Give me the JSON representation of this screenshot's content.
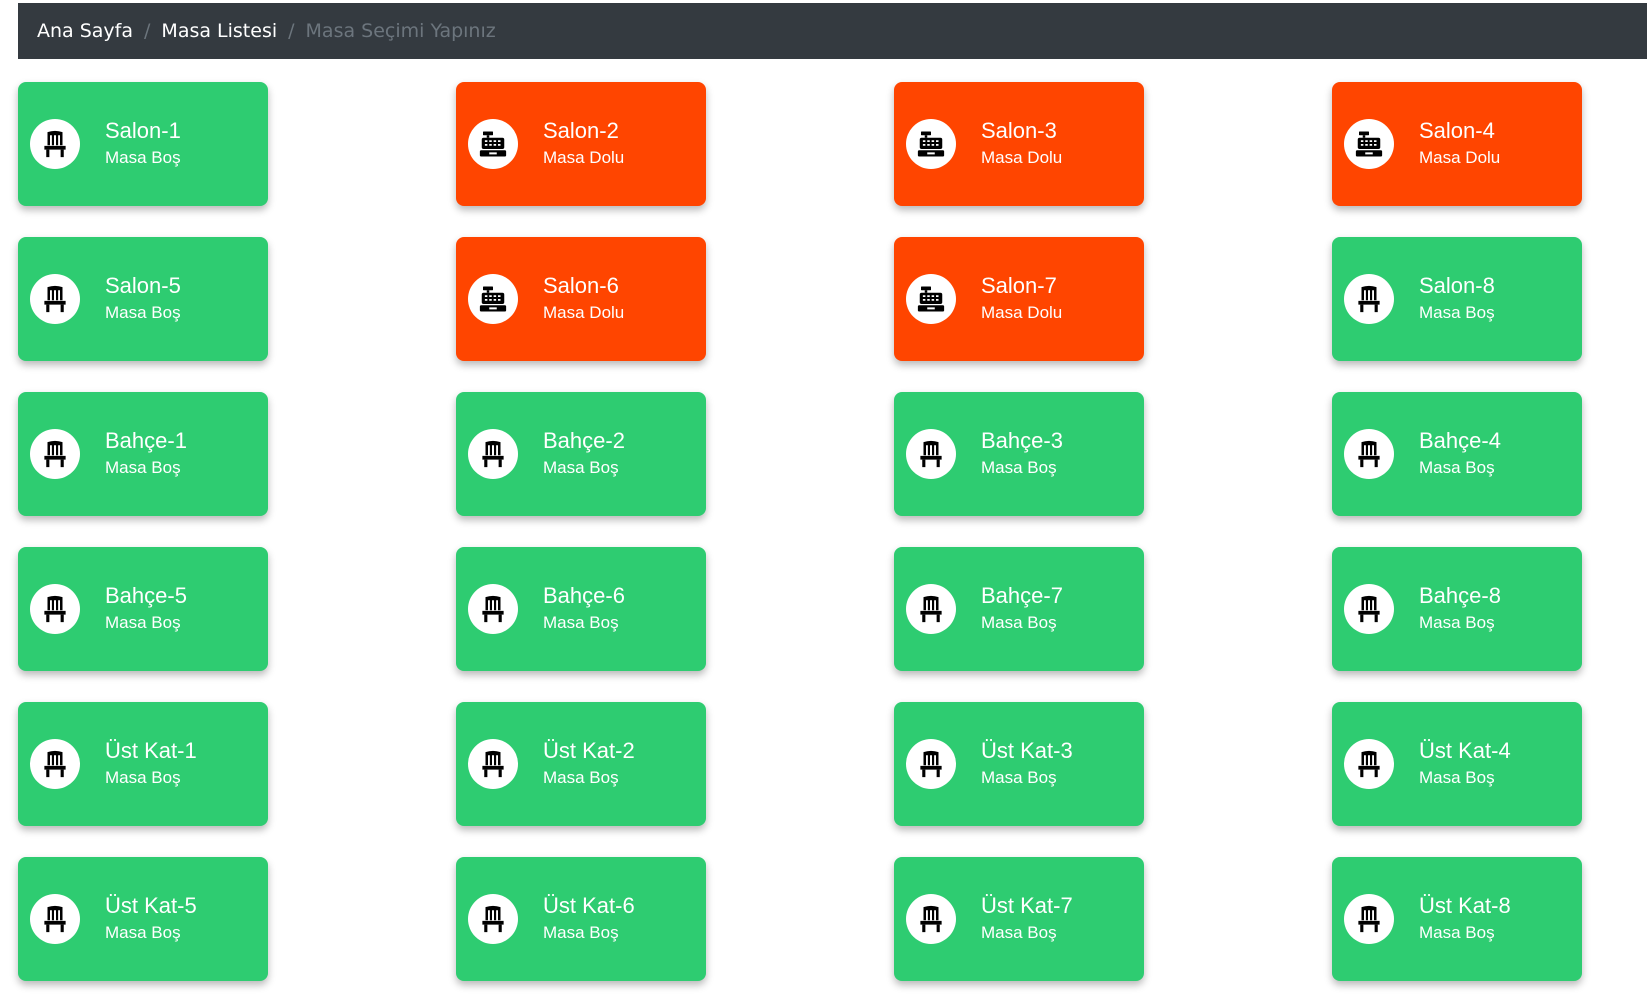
{
  "breadcrumb": {
    "home": "Ana Sayfa",
    "list": "Masa Listesi",
    "current": "Masa Seçimi Yapınız",
    "separator": "/"
  },
  "colors": {
    "empty": "#2ecc71",
    "full": "#ff4500",
    "breadcrumb_bg": "#343a40"
  },
  "status_icons": {
    "empty": "chair-icon",
    "full": "cash-register-icon"
  },
  "tables": [
    {
      "name": "Salon-1",
      "status_text": "Masa Boş",
      "state": "empty"
    },
    {
      "name": "Salon-2",
      "status_text": "Masa Dolu",
      "state": "full"
    },
    {
      "name": "Salon-3",
      "status_text": "Masa Dolu",
      "state": "full"
    },
    {
      "name": "Salon-4",
      "status_text": "Masa Dolu",
      "state": "full"
    },
    {
      "name": "Salon-5",
      "status_text": "Masa Boş",
      "state": "empty"
    },
    {
      "name": "Salon-6",
      "status_text": "Masa Dolu",
      "state": "full"
    },
    {
      "name": "Salon-7",
      "status_text": "Masa Dolu",
      "state": "full"
    },
    {
      "name": "Salon-8",
      "status_text": "Masa Boş",
      "state": "empty"
    },
    {
      "name": "Bahçe-1",
      "status_text": "Masa Boş",
      "state": "empty"
    },
    {
      "name": "Bahçe-2",
      "status_text": "Masa Boş",
      "state": "empty"
    },
    {
      "name": "Bahçe-3",
      "status_text": "Masa Boş",
      "state": "empty"
    },
    {
      "name": "Bahçe-4",
      "status_text": "Masa Boş",
      "state": "empty"
    },
    {
      "name": "Bahçe-5",
      "status_text": "Masa Boş",
      "state": "empty"
    },
    {
      "name": "Bahçe-6",
      "status_text": "Masa Boş",
      "state": "empty"
    },
    {
      "name": "Bahçe-7",
      "status_text": "Masa Boş",
      "state": "empty"
    },
    {
      "name": "Bahçe-8",
      "status_text": "Masa Boş",
      "state": "empty"
    },
    {
      "name": "Üst Kat-1",
      "status_text": "Masa Boş",
      "state": "empty"
    },
    {
      "name": "Üst Kat-2",
      "status_text": "Masa Boş",
      "state": "empty"
    },
    {
      "name": "Üst Kat-3",
      "status_text": "Masa Boş",
      "state": "empty"
    },
    {
      "name": "Üst Kat-4",
      "status_text": "Masa Boş",
      "state": "empty"
    },
    {
      "name": "Üst Kat-5",
      "status_text": "Masa Boş",
      "state": "empty"
    },
    {
      "name": "Üst Kat-6",
      "status_text": "Masa Boş",
      "state": "empty"
    },
    {
      "name": "Üst Kat-7",
      "status_text": "Masa Boş",
      "state": "empty"
    },
    {
      "name": "Üst Kat-8",
      "status_text": "Masa Boş",
      "state": "empty"
    }
  ]
}
